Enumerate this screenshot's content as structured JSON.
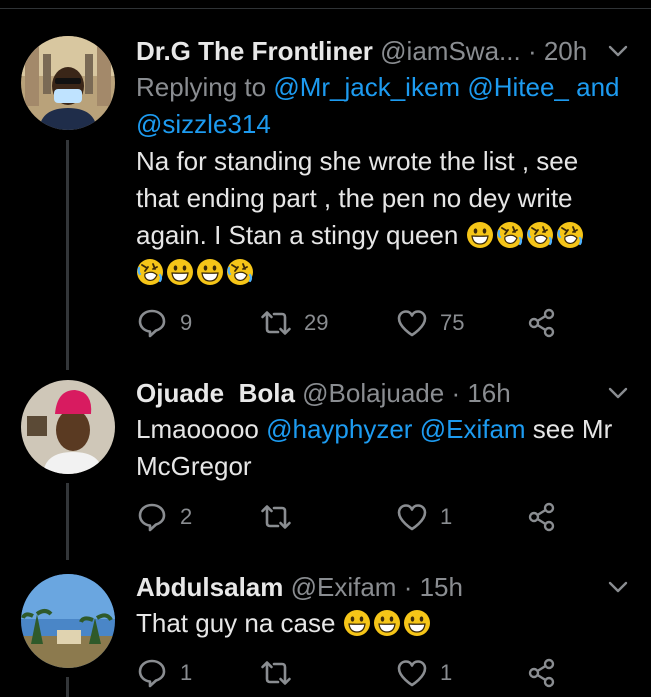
{
  "tweets": [
    {
      "display_name": "Dr.G The Frontliner",
      "handle": "@iamSwa...",
      "time": "· 20h",
      "replying_prefix": "Replying to ",
      "replying_mentions": [
        "@Mr_jack_ikem",
        "@Hitee_",
        "and",
        "@sizzle314"
      ],
      "text_lines": [
        "Na for standing she wrote the list , see",
        "that ending part , the pen no dey write",
        "again. I Stan a stingy queen"
      ],
      "emojis_line1": [
        "grin",
        "rofl",
        "rofl",
        "rofl"
      ],
      "emojis_line2": [
        "rofl",
        "grin",
        "grin",
        "rofl"
      ],
      "replies": "9",
      "retweets": "29",
      "likes": "75"
    },
    {
      "display_name": "Ojuade  Bola",
      "handle": "@Bolajuade",
      "time": "· 16h",
      "text_prefix": "Lmaooooo ",
      "mention1": "@hayphyzer",
      "mention2": "@Exifam",
      "text_suffix": " see Mr",
      "text_line2": "McGregor",
      "replies": "2",
      "retweets": "",
      "likes": "1"
    },
    {
      "display_name": "Abdulsalam",
      "handle": "@Exifam",
      "time": "· 15h",
      "text": "That guy na case",
      "emojis": [
        "grin",
        "grin",
        "grin"
      ],
      "replies": "1",
      "retweets": "",
      "likes": "1"
    }
  ],
  "icons": {
    "reply": "reply-icon",
    "retweet": "retweet-icon",
    "like": "heart-icon",
    "share": "share-icon",
    "more": "chevron-down-icon"
  },
  "colors": {
    "background": "#000000",
    "mention": "#1d9bf0",
    "secondary": "#8a8d91",
    "emoji": "#f5c518"
  }
}
